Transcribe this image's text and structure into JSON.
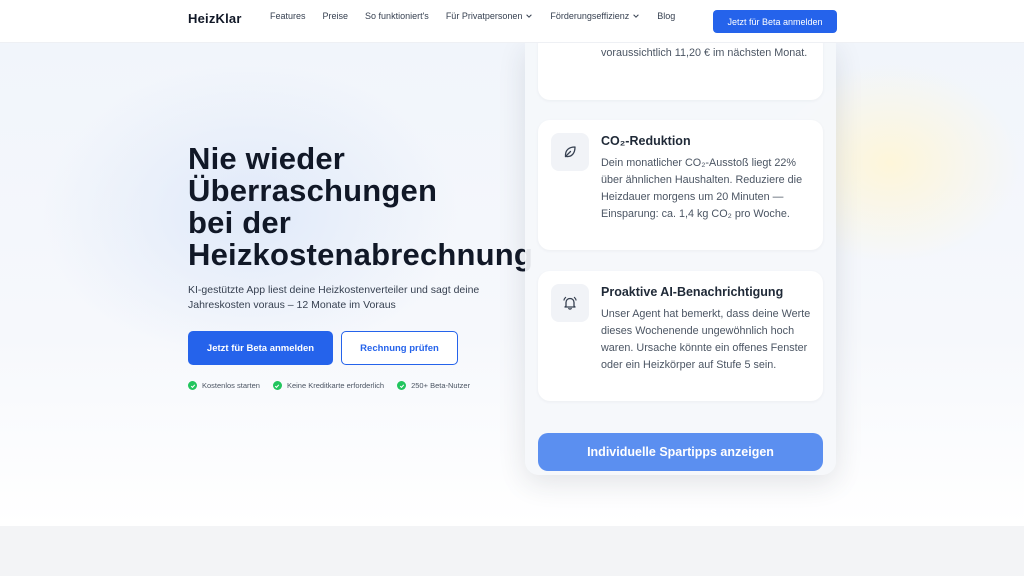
{
  "nav": {
    "logo": "HeizKlar",
    "links": [
      {
        "label": "Features"
      },
      {
        "label": "Preise"
      },
      {
        "label": "So funktioniert's"
      },
      {
        "label": "Für Privatpersonen"
      },
      {
        "label": "Förderungseffizienz"
      },
      {
        "label": "Blog"
      }
    ],
    "cta": "Jetzt für Beta anmelden"
  },
  "hero": {
    "headline_lines": [
      "Nie wieder",
      "Überraschungen",
      "bei der",
      "Heizkostenabrechnung"
    ],
    "subtitle": "KI-gestützte App liest deine Heizkostenverteiler und sagt deine Jahreskosten voraus – 12 Monate im Voraus",
    "primary_button": "Jetzt für Beta anmelden",
    "secondary_button": "Rechnung prüfen",
    "checks": [
      "Kostenlos starten",
      "Keine Kreditkarte erforderlich",
      "250+ Beta-Nutzer"
    ]
  },
  "panel": {
    "top_card_text": "voraussichtlich 11,20 € im nächsten Monat.",
    "co2_card": {
      "title": "CO₂-Reduktion",
      "text": "Dein monatlicher CO₂-Ausstoß liegt 22% über ähnlichen Haushalten. Reduziere die Heizdauer morgens um 20 Minuten — Einsparung: ca. 1,4 kg CO₂ pro Woche."
    },
    "ai_card": {
      "title": "Proaktive AI-Benachrichtigung",
      "text": "Unser Agent hat bemerkt, dass deine Werte dieses Wochenende ungewöhnlich hoch waren. Ursache könnte ein offenes Fenster oder ein Heizkörper auf Stufe 5 sein."
    },
    "button": "Individuelle Spartipps anzeigen"
  },
  "icons": {
    "co2": "leaf-icon",
    "ai": "bell-icon",
    "check": "check-icon",
    "chevron": "chevron-down-icon"
  },
  "colors": {
    "accent": "#2563eb",
    "check_green": "#22c55e",
    "panel_button": "#5b8ff0"
  }
}
